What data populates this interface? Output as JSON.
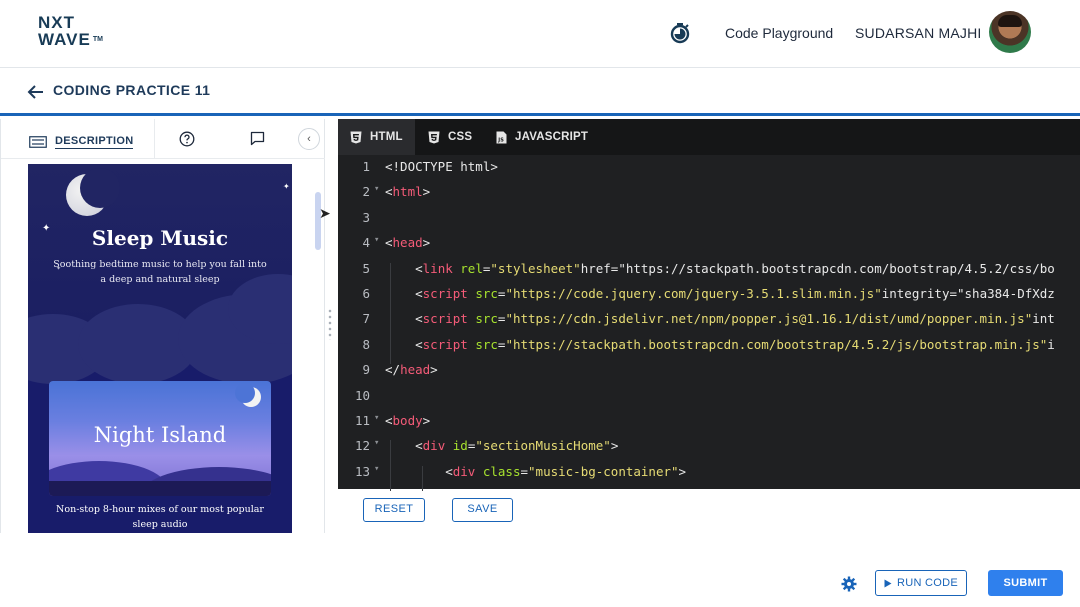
{
  "header": {
    "logo_line1": "NXT",
    "logo_line2": "WAVE",
    "logo_tm": "TM",
    "nav_link": "Code Playground",
    "user_name": "SUDARSAN MAJHI"
  },
  "subheader": {
    "title": "CODING PRACTICE 11"
  },
  "left_panel": {
    "tabs": {
      "description": "DESCRIPTION"
    },
    "preview": {
      "hero_title": "Sleep Music",
      "hero_subtitle": "Soothing bedtime music to help you fall into a deep and natural sleep",
      "card_title": "Night Island",
      "card_caption": "Non-stop 8-hour mixes of our most popular sleep audio"
    }
  },
  "editor": {
    "tabs": [
      {
        "label": "HTML",
        "active": true
      },
      {
        "label": "CSS",
        "active": false
      },
      {
        "label": "JAVASCRIPT",
        "active": false
      }
    ],
    "lines": [
      {
        "n": "1",
        "text": "<!DOCTYPE html>"
      },
      {
        "n": "2",
        "text": "<html>"
      },
      {
        "n": "3",
        "text": ""
      },
      {
        "n": "4",
        "text": "<head>"
      },
      {
        "n": "5",
        "text": "    <link rel=\"stylesheet\" href=\"https://stackpath.bootstrapcdn.com/bootstrap/4.5.2/css/bo"
      },
      {
        "n": "6",
        "text": "    <script src=\"https://code.jquery.com/jquery-3.5.1.slim.min.js\" integrity=\"sha384-DfXdz"
      },
      {
        "n": "7",
        "text": "    <script src=\"https://cdn.jsdelivr.net/npm/popper.js@1.16.1/dist/umd/popper.min.js\" int"
      },
      {
        "n": "8",
        "text": "    <script src=\"https://stackpath.bootstrapcdn.com/bootstrap/4.5.2/js/bootstrap.min.js\" i"
      },
      {
        "n": "9",
        "text": "</head>"
      },
      {
        "n": "10",
        "text": ""
      },
      {
        "n": "11",
        "text": "<body>"
      },
      {
        "n": "12",
        "text": "    <div id=\"sectionMusicHome\">"
      },
      {
        "n": "13",
        "text": "        <div class=\"music-bg-container\">"
      }
    ],
    "reset_label": "RESET",
    "save_label": "SAVE"
  },
  "footer": {
    "run_label": "RUN CODE",
    "submit_label": "SUBMIT"
  },
  "colors": {
    "brand_blue": "#1964b8",
    "submit_blue": "#2f80ed",
    "editor_bg": "#1f2022",
    "tag": "#f45b78",
    "attr": "#a7e22e",
    "string": "#e6db74"
  }
}
